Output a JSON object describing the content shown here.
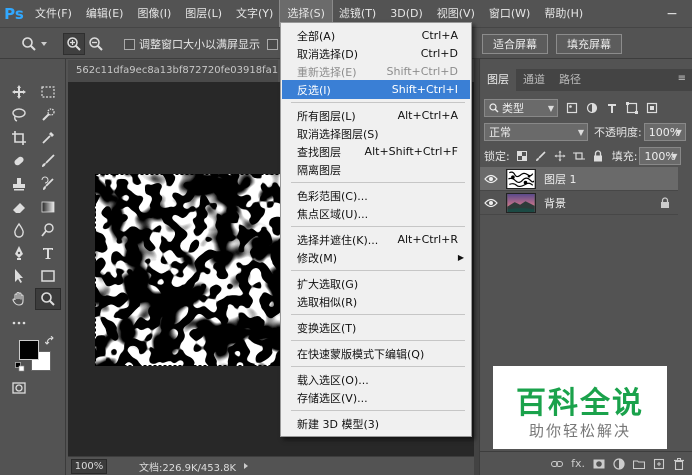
{
  "app": {
    "logo": "Ps"
  },
  "menubar": {
    "items": [
      "文件(F)",
      "编辑(E)",
      "图像(I)",
      "图层(L)",
      "文字(Y)",
      "选择(S)",
      "滤镜(T)",
      "3D(D)",
      "视图(V)",
      "窗口(W)",
      "帮助(H)"
    ],
    "active_index": 5,
    "minimize": "−"
  },
  "options": {
    "resize_window": "调整窗口大小以满屏显示",
    "fit_screen": "适合屏幕",
    "fill_screen": "填充屏幕"
  },
  "document": {
    "tab_title": "562c11dfa9ec8a13bf872720fe03918fa1ec",
    "zoom": "100%",
    "doc_info": "文档:226.9K/453.8K"
  },
  "layers_panel": {
    "tabs": [
      "图层",
      "通道",
      "路径"
    ],
    "active_tab": 0,
    "menu_icon": "≡",
    "filter_kind": "类型",
    "blend_mode": "正常",
    "opacity_label": "不透明度:",
    "opacity_value": "100%",
    "lock_label": "锁定:",
    "fill_label": "填充:",
    "fill_value": "100%",
    "layers": [
      {
        "name": "图层 1",
        "selected": true,
        "thumb": "pattern"
      },
      {
        "name": "背景",
        "selected": false,
        "thumb": "landscape",
        "locked": true
      }
    ],
    "bottom_fx": "fx."
  },
  "watermark": {
    "title": "百科全说",
    "subtitle": "助你轻松解决"
  },
  "select_menu": {
    "items": [
      {
        "label": "全部(A)",
        "shortcut": "Ctrl+A"
      },
      {
        "label": "取消选择(D)",
        "shortcut": "Ctrl+D"
      },
      {
        "label": "重新选择(E)",
        "shortcut": "Shift+Ctrl+D",
        "disabled": true
      },
      {
        "label": "反选(I)",
        "shortcut": "Shift+Ctrl+I",
        "highlight": true
      },
      {
        "label": "所有图层(L)",
        "shortcut": "Alt+Ctrl+A"
      },
      {
        "label": "取消选择图层(S)",
        "shortcut": ""
      },
      {
        "label": "查找图层",
        "shortcut": "Alt+Shift+Ctrl+F"
      },
      {
        "label": "隔离图层",
        "shortcut": ""
      },
      {
        "label": "色彩范围(C)...",
        "shortcut": ""
      },
      {
        "label": "焦点区域(U)...",
        "shortcut": ""
      },
      {
        "label": "选择并遮住(K)...",
        "shortcut": "Alt+Ctrl+R"
      },
      {
        "label": "修改(M)",
        "shortcut": "",
        "submenu": true
      },
      {
        "label": "扩大选取(G)",
        "shortcut": ""
      },
      {
        "label": "选取相似(R)",
        "shortcut": ""
      },
      {
        "label": "变换选区(T)",
        "shortcut": ""
      },
      {
        "label": "在快速蒙版模式下编辑(Q)",
        "shortcut": ""
      },
      {
        "label": "载入选区(O)...",
        "shortcut": ""
      },
      {
        "label": "存储选区(V)...",
        "shortcut": ""
      },
      {
        "label": "新建 3D 模型(3)",
        "shortcut": ""
      }
    ]
  }
}
